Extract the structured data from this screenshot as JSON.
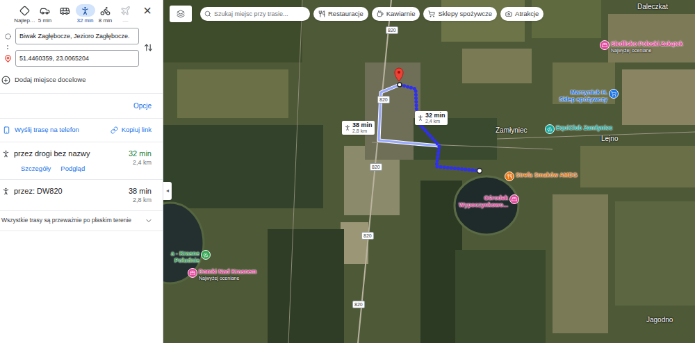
{
  "panel": {
    "travel_modes": [
      {
        "kind": "best",
        "label": "Najlep…",
        "selected": false,
        "disabled": false
      },
      {
        "kind": "car",
        "label": "5 min",
        "selected": false,
        "disabled": false
      },
      {
        "kind": "transit",
        "label": "",
        "selected": false,
        "disabled": false
      },
      {
        "kind": "walk",
        "label": "32 min",
        "selected": true,
        "disabled": false
      },
      {
        "kind": "bike",
        "label": "8 min",
        "selected": false,
        "disabled": false
      },
      {
        "kind": "plane",
        "label": "—",
        "selected": false,
        "disabled": true
      }
    ],
    "close": "×",
    "origin": "Biwak Zagłębocze, Jezioro Zagłębocze.",
    "destination": "51.4460359, 23.0065204",
    "add_destination": "Dodaj miejsce docelowe",
    "options": "Opcje",
    "send_to_phone": "Wyślij trasę na telefon",
    "copy_link": "Kopiuj link",
    "routes": [
      {
        "via": "przez drogi bez nazwy",
        "time": "32 min",
        "distance": "2,4 km",
        "selected": true,
        "actions": [
          "Szczegóły",
          "Podgląd"
        ]
      },
      {
        "via": "przez: DW820",
        "time": "38 min",
        "distance": "2,8 km",
        "selected": false,
        "actions": []
      }
    ],
    "terrain_note": "Wszystkie trasy są przeważnie po płaskim terenie",
    "collapse": "◂"
  },
  "map": {
    "search_placeholder": "Szukaj miejsc przy trasie...",
    "chips": [
      {
        "kind": "food",
        "label": "Restauracje"
      },
      {
        "kind": "cafe",
        "label": "Kawiarnie"
      },
      {
        "kind": "grocery",
        "label": "Sklepy spożywcze"
      },
      {
        "kind": "attraction",
        "label": "Atrakcje"
      }
    ],
    "road_shields": [
      "820",
      "820",
      "820",
      "820",
      "820"
    ],
    "places": [
      "Daleczkat",
      "Zamłyniec",
      "Lejno",
      "Jagodno"
    ],
    "pois": [
      {
        "kind": "hotel",
        "lines": [
          "Siedlisko Poleski Zakątek"
        ],
        "sub": "Najwyżej oceniane",
        "color": "#e4429b"
      },
      {
        "kind": "shop",
        "lines": [
          "Marcyniuk H.",
          "Sklep spożywczy"
        ],
        "sub": "",
        "color": "#1a73e8"
      },
      {
        "kind": "leisure",
        "lines": [
          "EquiClub Zamłyniec"
        ],
        "sub": "",
        "color": "#13a89e"
      },
      {
        "kind": "food",
        "lines": [
          "Strefa Smaków AMDG"
        ],
        "sub": "",
        "color": "#e8710a"
      },
      {
        "kind": "hotel",
        "lines": [
          "Ośrodek",
          "Wypoczynkowo..."
        ],
        "sub": "",
        "color": "#e4429b"
      },
      {
        "kind": "park",
        "lines": [
          "a - Krasne",
          "Południe"
        ],
        "sub": "",
        "color": "#34a853"
      },
      {
        "kind": "hotel",
        "lines": [
          "Domki Nad Krasnem"
        ],
        "sub": "Najwyżej oceniane",
        "color": "#e4429b"
      }
    ]
  }
}
